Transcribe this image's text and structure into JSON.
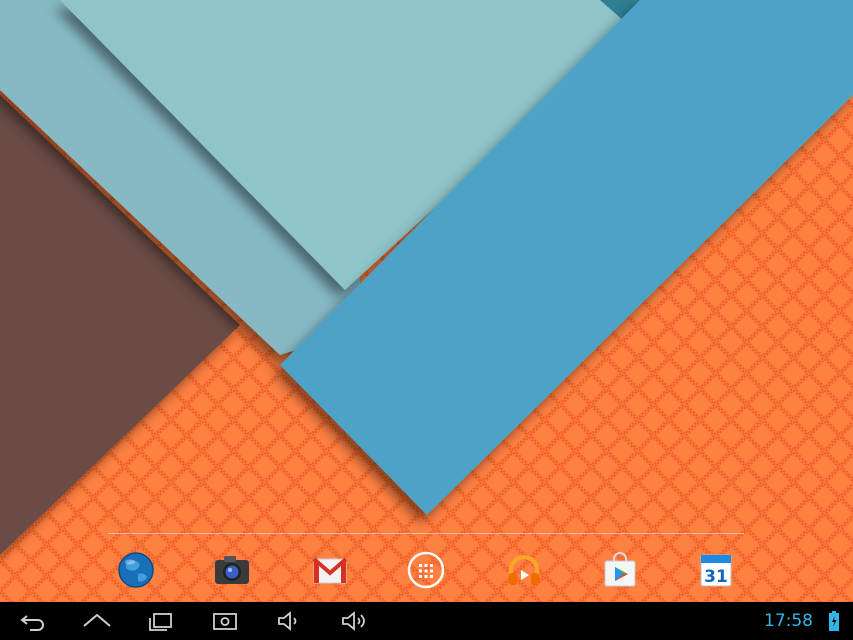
{
  "wallpaper": {
    "colors": {
      "orange": "#ff7a3a",
      "brown": "#6b4c44",
      "light_teal": "#86b9c4",
      "pale_teal": "#8cc3c7",
      "blue": "#4da3c7"
    }
  },
  "dock": {
    "items": [
      {
        "icon": "browser-globe-icon"
      },
      {
        "icon": "camera-icon"
      },
      {
        "icon": "gmail-icon"
      },
      {
        "icon": "all-apps-icon"
      },
      {
        "icon": "play-music-icon"
      },
      {
        "icon": "play-store-icon"
      },
      {
        "icon": "calendar-icon",
        "label": "31"
      }
    ]
  },
  "navbar": {
    "buttons": [
      "back-icon",
      "home-icon",
      "recent-apps-icon",
      "screenshot-icon",
      "volume-down-icon",
      "volume-up-icon"
    ],
    "clock": "17:58",
    "battery_icon": "battery-charging-icon",
    "accent": "#33b5e5"
  }
}
